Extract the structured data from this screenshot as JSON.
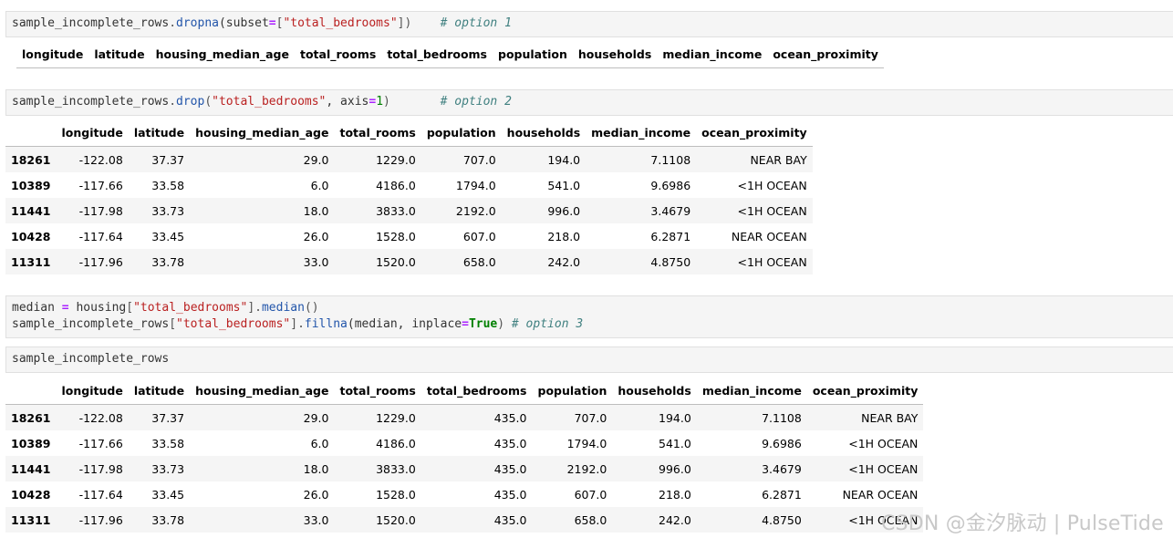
{
  "cells": [
    {
      "lines": [
        [
          {
            "t": "sample_incomplete_rows",
            "c": ""
          },
          {
            "t": ".",
            "c": "pun"
          },
          {
            "t": "dropna",
            "c": "fn"
          },
          {
            "t": "(subset",
            "c": ""
          },
          {
            "t": "=",
            "c": "kw-op"
          },
          {
            "t": "[",
            "c": "pun"
          },
          {
            "t": "\"total_bedrooms\"",
            "c": "str"
          },
          {
            "t": "])",
            "c": "pun"
          },
          {
            "t": "    ",
            "c": ""
          },
          {
            "t": "# option 1",
            "c": "cm"
          }
        ]
      ]
    },
    {
      "lines": [
        [
          {
            "t": "sample_incomplete_rows",
            "c": ""
          },
          {
            "t": ".",
            "c": "pun"
          },
          {
            "t": "drop",
            "c": "fn"
          },
          {
            "t": "(",
            "c": "pun"
          },
          {
            "t": "\"total_bedrooms\"",
            "c": "str"
          },
          {
            "t": ", axis",
            "c": ""
          },
          {
            "t": "=",
            "c": "kw-op"
          },
          {
            "t": "1",
            "c": "num"
          },
          {
            "t": ")",
            "c": "pun"
          },
          {
            "t": "       ",
            "c": ""
          },
          {
            "t": "# option 2",
            "c": "cm"
          }
        ]
      ]
    },
    {
      "lines": [
        [
          {
            "t": "median ",
            "c": ""
          },
          {
            "t": "=",
            "c": "kw-op"
          },
          {
            "t": " housing",
            "c": ""
          },
          {
            "t": "[",
            "c": "pun"
          },
          {
            "t": "\"total_bedrooms\"",
            "c": "str"
          },
          {
            "t": "].",
            "c": "pun"
          },
          {
            "t": "median",
            "c": "fn"
          },
          {
            "t": "()",
            "c": "pun"
          }
        ],
        [
          {
            "t": "sample_incomplete_rows",
            "c": ""
          },
          {
            "t": "[",
            "c": "pun"
          },
          {
            "t": "\"total_bedrooms\"",
            "c": "str"
          },
          {
            "t": "].",
            "c": "pun"
          },
          {
            "t": "fillna",
            "c": "fn"
          },
          {
            "t": "(median, inplace",
            "c": ""
          },
          {
            "t": "=",
            "c": "kw-op"
          },
          {
            "t": "True",
            "c": "kw"
          },
          {
            "t": ") ",
            "c": "pun"
          },
          {
            "t": "# option 3",
            "c": "cm"
          }
        ]
      ]
    },
    {
      "lines": [
        [
          {
            "t": "sample_incomplete_rows",
            "c": ""
          }
        ]
      ]
    }
  ],
  "tables": [
    {
      "columns": [
        "longitude",
        "latitude",
        "housing_median_age",
        "total_rooms",
        "total_bedrooms",
        "population",
        "households",
        "median_income",
        "ocean_proximity"
      ],
      "index_header": "",
      "rows": []
    },
    {
      "columns": [
        "longitude",
        "latitude",
        "housing_median_age",
        "total_rooms",
        "population",
        "households",
        "median_income",
        "ocean_proximity"
      ],
      "index_header": "",
      "rows": [
        [
          "18261",
          "-122.08",
          "37.37",
          "29.0",
          "1229.0",
          "707.0",
          "194.0",
          "7.1108",
          "NEAR BAY"
        ],
        [
          "10389",
          "-117.66",
          "33.58",
          "6.0",
          "4186.0",
          "1794.0",
          "541.0",
          "9.6986",
          "<1H OCEAN"
        ],
        [
          "11441",
          "-117.98",
          "33.73",
          "18.0",
          "3833.0",
          "2192.0",
          "996.0",
          "3.4679",
          "<1H OCEAN"
        ],
        [
          "10428",
          "-117.64",
          "33.45",
          "26.0",
          "1528.0",
          "607.0",
          "218.0",
          "6.2871",
          "NEAR OCEAN"
        ],
        [
          "11311",
          "-117.96",
          "33.78",
          "33.0",
          "1520.0",
          "658.0",
          "242.0",
          "4.8750",
          "<1H OCEAN"
        ]
      ]
    },
    {
      "columns": [
        "longitude",
        "latitude",
        "housing_median_age",
        "total_rooms",
        "total_bedrooms",
        "population",
        "households",
        "median_income",
        "ocean_proximity"
      ],
      "index_header": "",
      "rows": [
        [
          "18261",
          "-122.08",
          "37.37",
          "29.0",
          "1229.0",
          "435.0",
          "707.0",
          "194.0",
          "7.1108",
          "NEAR BAY"
        ],
        [
          "10389",
          "-117.66",
          "33.58",
          "6.0",
          "4186.0",
          "435.0",
          "1794.0",
          "541.0",
          "9.6986",
          "<1H OCEAN"
        ],
        [
          "11441",
          "-117.98",
          "33.73",
          "18.0",
          "3833.0",
          "435.0",
          "2192.0",
          "996.0",
          "3.4679",
          "<1H OCEAN"
        ],
        [
          "10428",
          "-117.64",
          "33.45",
          "26.0",
          "1528.0",
          "435.0",
          "607.0",
          "218.0",
          "6.2871",
          "NEAR OCEAN"
        ],
        [
          "11311",
          "-117.96",
          "33.78",
          "33.0",
          "1520.0",
          "435.0",
          "658.0",
          "242.0",
          "4.8750",
          "<1H OCEAN"
        ]
      ]
    }
  ],
  "watermark": "CSDN @金汐脉动 | PulseTide"
}
